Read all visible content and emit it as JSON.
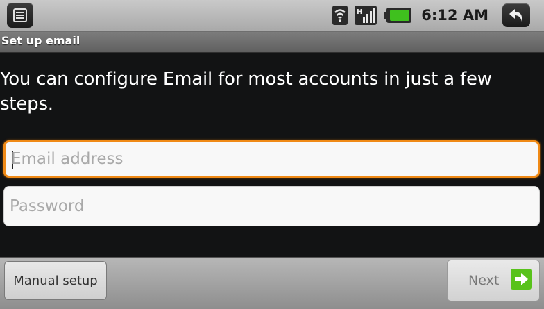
{
  "status_bar": {
    "time": "6:12 AM",
    "icons": [
      "menu-icon",
      "wifi-icon",
      "signal-icon",
      "battery-icon",
      "back-icon"
    ]
  },
  "title_bar": {
    "title": "Set up email"
  },
  "content": {
    "intro": "You can configure Email for most accounts in just a few steps.",
    "email_field": {
      "placeholder": "Email address",
      "value": ""
    },
    "password_field": {
      "placeholder": "Password",
      "value": ""
    }
  },
  "buttons": {
    "manual_setup": "Manual setup",
    "next": "Next"
  },
  "colors": {
    "focus": "#f08a16",
    "next_arrow": "#58c21b",
    "battery": "#3fc01e"
  }
}
